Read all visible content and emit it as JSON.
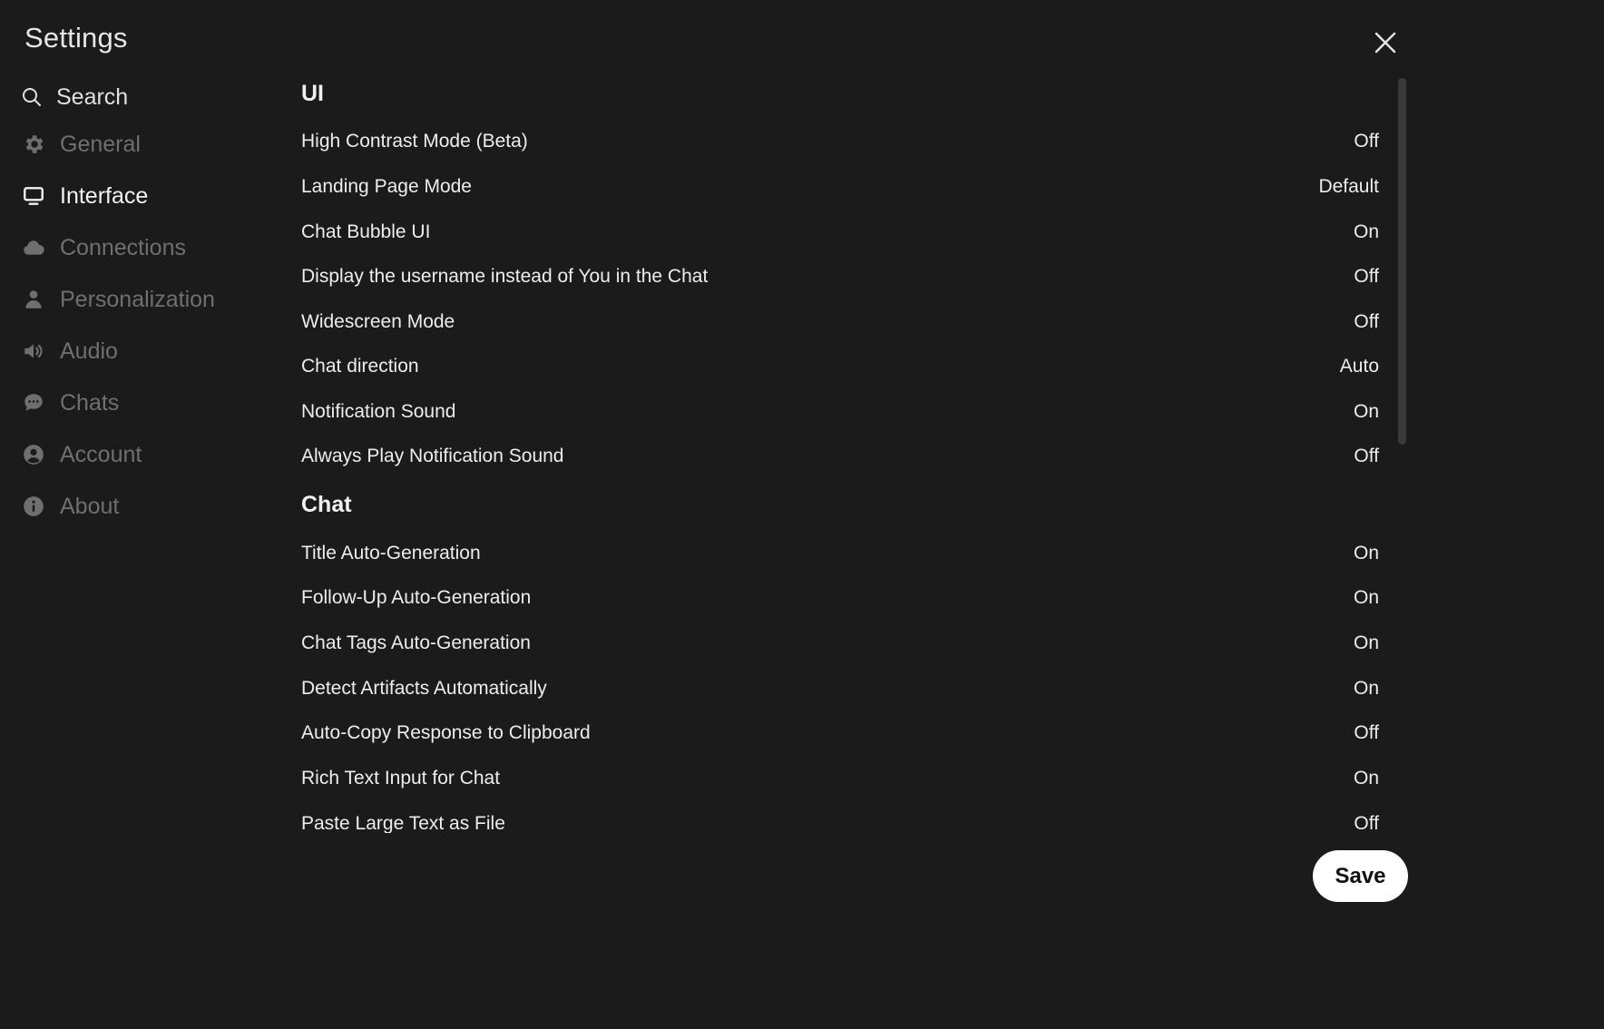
{
  "title": "Settings",
  "search": {
    "label": "Search"
  },
  "sidebar": {
    "items": [
      {
        "label": "General",
        "icon": "gear-icon",
        "active": false
      },
      {
        "label": "Interface",
        "icon": "monitor-icon",
        "active": true
      },
      {
        "label": "Connections",
        "icon": "cloud-icon",
        "active": false
      },
      {
        "label": "Personalization",
        "icon": "user-icon",
        "active": false
      },
      {
        "label": "Audio",
        "icon": "speaker-icon",
        "active": false
      },
      {
        "label": "Chats",
        "icon": "chat-bubble-icon",
        "active": false
      },
      {
        "label": "Account",
        "icon": "account-circle-icon",
        "active": false
      },
      {
        "label": "About",
        "icon": "info-icon",
        "active": false
      }
    ]
  },
  "sections": [
    {
      "title": "UI",
      "rows": [
        {
          "label": "High Contrast Mode (Beta)",
          "value": "Off"
        },
        {
          "label": "Landing Page Mode",
          "value": "Default"
        },
        {
          "label": "Chat Bubble UI",
          "value": "On"
        },
        {
          "label": "Display the username instead of You in the Chat",
          "value": "Off"
        },
        {
          "label": "Widescreen Mode",
          "value": "Off"
        },
        {
          "label": "Chat direction",
          "value": "Auto"
        },
        {
          "label": "Notification Sound",
          "value": "On"
        },
        {
          "label": "Always Play Notification Sound",
          "value": "Off"
        }
      ]
    },
    {
      "title": "Chat",
      "rows": [
        {
          "label": "Title Auto-Generation",
          "value": "On"
        },
        {
          "label": "Follow-Up Auto-Generation",
          "value": "On"
        },
        {
          "label": "Chat Tags Auto-Generation",
          "value": "On"
        },
        {
          "label": "Detect Artifacts Automatically",
          "value": "On"
        },
        {
          "label": "Auto-Copy Response to Clipboard",
          "value": "Off"
        },
        {
          "label": "Rich Text Input for Chat",
          "value": "On"
        },
        {
          "label": "Paste Large Text as File",
          "value": "Off"
        }
      ]
    }
  ],
  "save_label": "Save"
}
